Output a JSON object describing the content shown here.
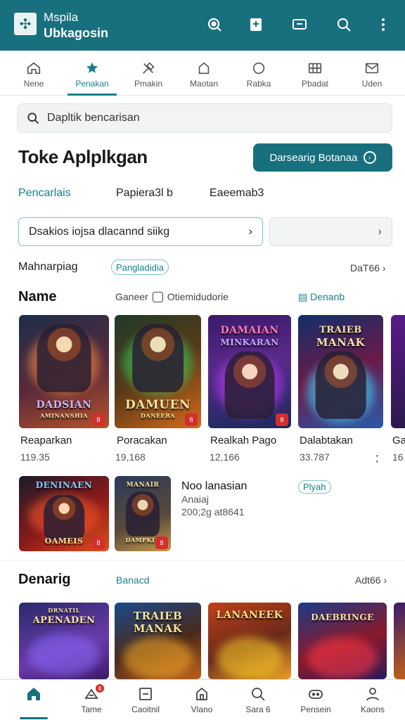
{
  "app": {
    "title_line1": "Mspila",
    "title_line2": "Ubkagosin",
    "logo_icon": "puzzle-logo",
    "brand_color": "#186f7d",
    "accent_color": "#16808f",
    "actions": [
      "search-target-icon",
      "bookmark-icon",
      "cast-icon",
      "search-icon",
      "more-vert-icon"
    ]
  },
  "tabs": [
    {
      "label": "Nene",
      "icon": "home-icon",
      "active": false
    },
    {
      "label": "Penakan",
      "icon": "star-icon",
      "active": true
    },
    {
      "label": "Pmakin",
      "icon": "tools-icon",
      "active": false
    },
    {
      "label": "Maotan",
      "icon": "house-icon",
      "active": false
    },
    {
      "label": "Rabka",
      "icon": "circle-icon",
      "active": false
    },
    {
      "label": "Pbadat",
      "icon": "grid-icon",
      "active": false
    },
    {
      "label": "Uden",
      "icon": "mail-icon",
      "active": false
    }
  ],
  "search": {
    "placeholder": "Dapltik bencarisan"
  },
  "page": {
    "title": "Toke Aplplkgan",
    "primary_button": "Darsearig Botanaa",
    "subtabs": [
      "Pencarlais",
      "Papiera3l b",
      "Eaeemab3"
    ],
    "dropdown_primary": "Dsakios iojsa dlacannd siikg",
    "dropdown_secondary": "",
    "filter_label": "Mahnarpiag",
    "filter_chip": "Pangladidia",
    "filter_see_all": "DaT66 ›"
  },
  "section1": {
    "title": "Name",
    "meta_label": "Ganeer",
    "checkbox_label": "Otiemidudorie",
    "link_label": "Denanb",
    "games": [
      {
        "name": "Reaparkan",
        "count": "119.35",
        "cover_title": "DADSIAN",
        "cover_sub": "AMINANSHIA",
        "badge": "8"
      },
      {
        "name": "Poracakan",
        "count": "19,168",
        "cover_title": "DAMUEN",
        "cover_sub": "DANEERA",
        "badge": "8"
      },
      {
        "name": "Realkah Pago",
        "count": "12,166",
        "cover_title": "DAMAIAN",
        "cover_sub": "MINKARAN",
        "badge": "8"
      },
      {
        "name": "Dalabtakan",
        "count": "33.787",
        "cover_title": "TRAIEB",
        "cover_sub": "MANAK",
        "badge": ""
      },
      {
        "name": "Ga",
        "count": "16",
        "cover_title": "",
        "cover_sub": "",
        "badge": ""
      }
    ],
    "featured": [
      {
        "cover_title": "DENINAEN",
        "cover_sub": "OAMEIS",
        "badge": "8"
      },
      {
        "cover_title": "MANAIR",
        "cover_sub": "DAMPKIB",
        "badge": "8"
      }
    ],
    "featured_title": "Noo lanasian",
    "featured_sub": "Anaiaj",
    "featured_count": "200;2g at8641",
    "featured_chip": "Plyah"
  },
  "section2": {
    "title": "Denarig",
    "link_label": "Banacd",
    "see_all": "Adt66 ›",
    "games": [
      {
        "cover_title": "APENADEN",
        "cover_sub": "DRNATIL"
      },
      {
        "cover_title": "TRAIEB MANAK",
        "cover_sub": ""
      },
      {
        "cover_title": "LANANEEK",
        "cover_sub": ""
      },
      {
        "cover_title": "DAEBRINGE",
        "cover_sub": ""
      }
    ]
  },
  "bottom_nav": [
    {
      "label": "",
      "icon": "home-icon",
      "active": true
    },
    {
      "label": "Tame",
      "icon": "notification-icon",
      "badge": "8"
    },
    {
      "label": "Caoitnil",
      "icon": "square-minus-icon"
    },
    {
      "label": "Vlano",
      "icon": "house-icon"
    },
    {
      "label": "Sara 6",
      "icon": "search-icon"
    },
    {
      "label": "Pensein",
      "icon": "gamepad-icon"
    },
    {
      "label": "Kaons",
      "icon": "person-icon"
    }
  ]
}
